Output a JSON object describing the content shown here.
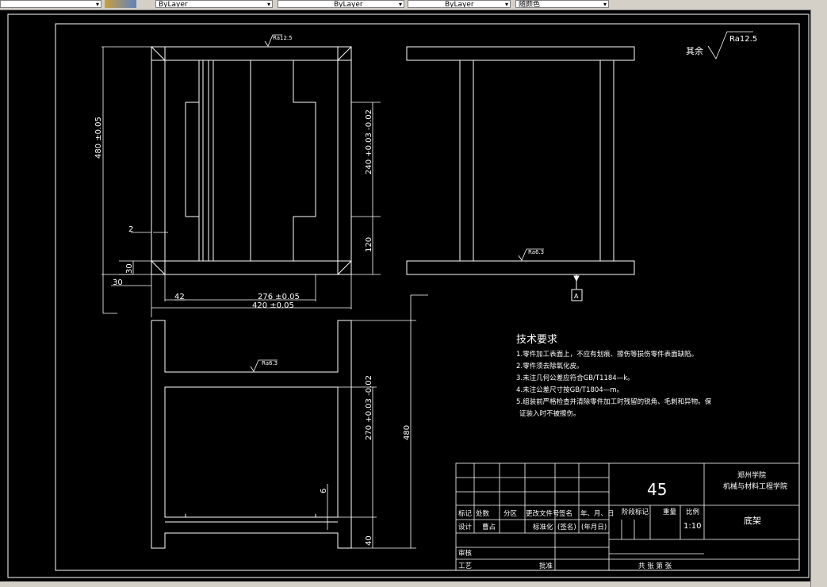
{
  "toolbar": {
    "layer_dropdown": "ByLayer",
    "linetype_dropdown": "ByLayer",
    "lineweight_dropdown": "ByLayer",
    "color_dropdown": "随颜色"
  },
  "drawing": {
    "dims": {
      "height_480": "480 ±0.05",
      "width_420": "420 ±0.05",
      "width_276": "276 ±0.05",
      "dim_42": "42",
      "dim_30a": "30",
      "dim_30b": "30",
      "dim_2": "2",
      "dim_240": "240 +0.03 -0.02",
      "dim_120": "120",
      "dim_270": "270 +0.03 -0.02",
      "dim_480b": "480",
      "dim_6": "6",
      "dim_40": "40"
    },
    "roughness": {
      "top": "Ra12.5",
      "rest_label": "其余",
      "rest_value": "Ra12.5",
      "side": "Ra6.3",
      "bottom_view": "Ra6.3"
    },
    "datum": "A",
    "tech": {
      "title": "技术要求",
      "lines": [
        "1.零件加工表面上，不应有划痕、擦伤等损伤零件表面缺陷。",
        "2.零件须去除氧化皮。",
        "3.未注几何公差应符合GB/T1184—k。",
        "4.未注公差尺寸按GB/T1804—m。",
        "5.组装前严格检查并清除零件加工时残留的锐角、毛刺和异物。保",
        "证装入时不被擦伤。"
      ]
    },
    "title_block": {
      "material": "45",
      "school_1": "郑州学院",
      "school_2": "机械与材料工程学院",
      "part_name": "底架",
      "stage_mark": "阶段标记",
      "weight": "重量",
      "scale_label": "比例",
      "scale": "1:10",
      "h_mark": "标记",
      "h_count": "处数",
      "h_zone": "分区",
      "h_change": "更改文件号",
      "h_sign": "签名",
      "h_date": "年、月、日",
      "designer": "设计",
      "designer_name": "曹占",
      "standard": "标准化",
      "sign2": "(签名)",
      "date2": "(年月日)",
      "review": "审核",
      "process": "工艺",
      "approve": "批准",
      "sheets": "共 张  第 张"
    }
  }
}
